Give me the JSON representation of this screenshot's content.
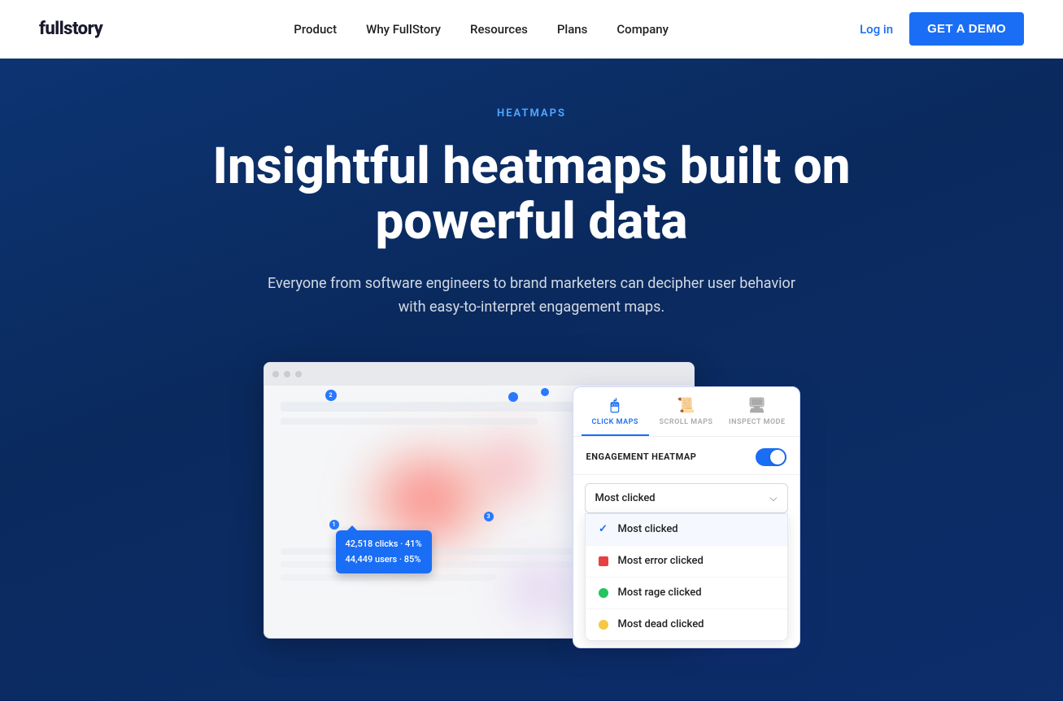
{
  "nav": {
    "logo": "fullstory",
    "links": [
      {
        "id": "product",
        "label": "Product"
      },
      {
        "id": "why-fullstory",
        "label": "Why FullStory"
      },
      {
        "id": "resources",
        "label": "Resources"
      },
      {
        "id": "plans",
        "label": "Plans"
      },
      {
        "id": "company",
        "label": "Company"
      }
    ],
    "login_label": "Log in",
    "demo_label": "GET A DEMO"
  },
  "hero": {
    "label": "HEATMAPS",
    "title": "Insightful heatmaps built on powerful data",
    "subtitle": "Everyone from software engineers to brand marketers can decipher user behavior with easy-to-interpret engagement maps."
  },
  "heatmap_ui": {
    "tooltip": {
      "line1": "42,518 clicks · 41%",
      "line2": "44,449 users · 85%"
    },
    "panel": {
      "tabs": [
        {
          "id": "click-maps",
          "label": "CLICK MAPS",
          "icon": "🖱"
        },
        {
          "id": "scroll-maps",
          "label": "SCROLL MAPS",
          "icon": "📜"
        },
        {
          "id": "inspect-mode",
          "label": "INSPECT MODE",
          "icon": "🖥"
        }
      ],
      "engagement_label": "ENGAGEMENT HEATMAP",
      "dropdown_selected": "Most clicked",
      "dropdown_items": [
        {
          "id": "most-clicked",
          "label": "Most clicked",
          "selected": true,
          "icon_type": "check"
        },
        {
          "id": "most-error-clicked",
          "label": "Most error clicked",
          "selected": false,
          "icon_type": "error"
        },
        {
          "id": "most-rage-clicked",
          "label": "Most rage clicked",
          "selected": false,
          "icon_type": "rage"
        },
        {
          "id": "most-dead-clicked",
          "label": "Most dead clicked",
          "selected": false,
          "icon_type": "dead"
        }
      ]
    }
  }
}
